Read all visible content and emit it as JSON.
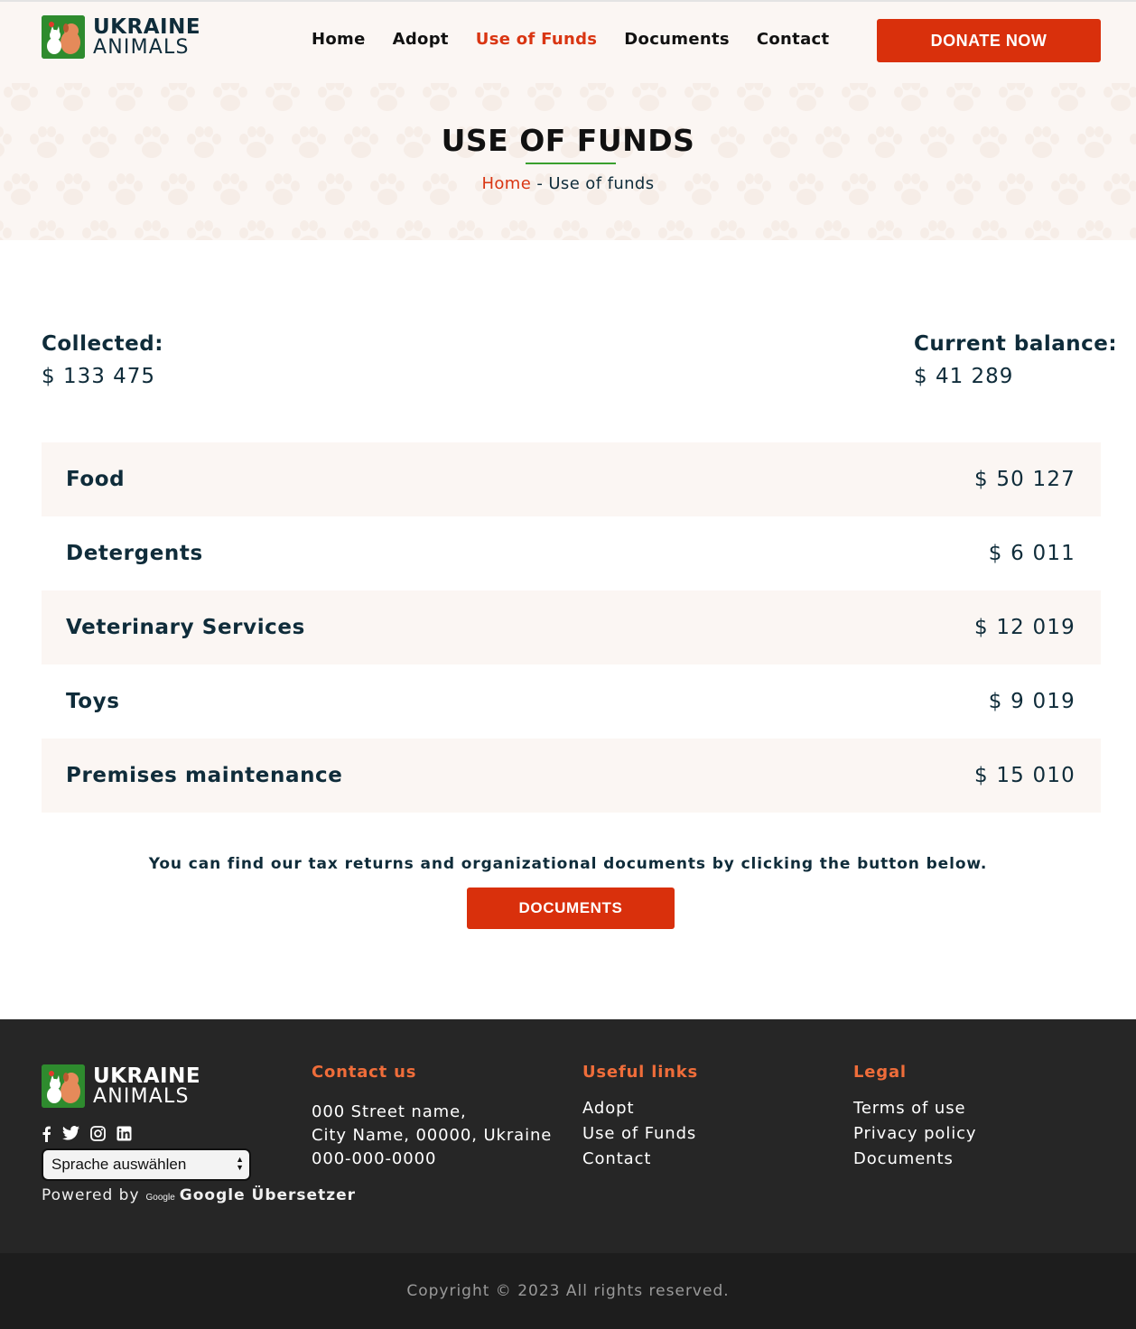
{
  "brand": {
    "line1": "UKRAINE",
    "line2": "ANIMALS"
  },
  "nav": {
    "items": [
      {
        "label": "Home"
      },
      {
        "label": "Adopt"
      },
      {
        "label": "Use of Funds"
      },
      {
        "label": "Documents"
      },
      {
        "label": "Contact"
      }
    ],
    "active": "Use of Funds",
    "donate_label": "DONATE NOW"
  },
  "banner": {
    "title": "USE OF FUNDS",
    "breadcrumb": {
      "home": "Home",
      "separator": " - ",
      "current": "Use of funds"
    }
  },
  "totals": {
    "collected": {
      "label": "Collected:",
      "value": "$ 133 475"
    },
    "balance": {
      "label": "Current balance:",
      "value": "$ 41 289"
    }
  },
  "funds": [
    {
      "category": "Food",
      "amount": "$ 50 127"
    },
    {
      "category": "Detergents",
      "amount": "$ 6 011"
    },
    {
      "category": "Veterinary Services",
      "amount": "$ 12 019"
    },
    {
      "category": "Toys",
      "amount": "$ 9 019"
    },
    {
      "category": "Premises maintenance",
      "amount": "$ 15 010"
    }
  ],
  "documents": {
    "note": "You can find our tax returns and organizational documents by clicking the button below.",
    "button_label": "DOCUMENTS"
  },
  "footer": {
    "socials": [
      "facebook-icon",
      "twitter-icon",
      "instagram-icon",
      "linkedin-icon"
    ],
    "language_select": "Sprache auswählen",
    "powered_by": "Powered by",
    "google_logo": "Google",
    "translator": "Google Übersetzer",
    "contact": {
      "heading": "Contact us",
      "lines": [
        "000 Street name,",
        "City Name, 00000, Ukraine",
        "000-000-0000"
      ]
    },
    "useful_links": {
      "heading": "Useful links",
      "links": [
        "Adopt",
        "Use of Funds",
        "Contact"
      ]
    },
    "legal": {
      "heading": "Legal",
      "links": [
        "Terms of use",
        "Privacy policy",
        "Documents"
      ]
    },
    "copyright": "Copyright © 2023 All rights reserved."
  },
  "colors": {
    "accent": "#d9300c",
    "heading_orange": "#ef6d3a",
    "navy": "#0f2c3a",
    "cream": "#fbf6f3",
    "footer_bg": "#262626",
    "logo_green": "#2e8b2e"
  }
}
